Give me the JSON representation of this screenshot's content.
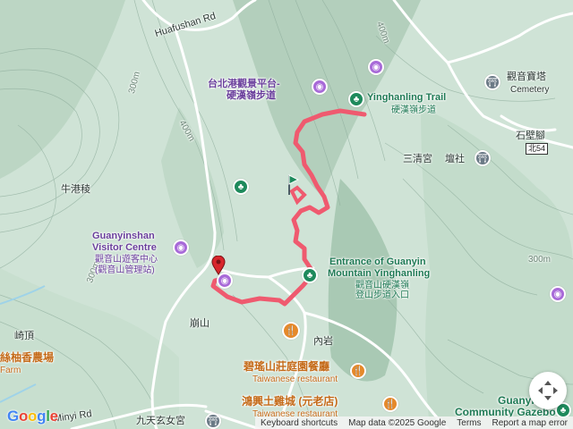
{
  "map": {
    "colors": {
      "terrain": "#cfe3d6",
      "ridge": "#9fc2ad",
      "contour": "#86a897",
      "road": "#ffffff",
      "route": "#ef5a6f",
      "water": "#9fd3e8"
    }
  },
  "labels": {
    "huafushan_rd": "Huafushan Rd",
    "guanyin_viewing_zh": "台北港觀景平台-",
    "guanyin_viewing_zh2": "硬漢嶺步道",
    "yinghanling_trail": "Yinghanling Trail",
    "yinghanling_trail_zh": "硬漢嶺步道",
    "guanyin_temple_zh": "觀音寶塔",
    "cemetery": "Cemetery",
    "shibijiao": "石壁腳",
    "route_bei54": "北54",
    "sanqing": "三清宮",
    "tanshe": "壇社",
    "niugangleng": "牛港稜",
    "visitor_centre_en1": "Guanyinshan",
    "visitor_centre_en2": "Visitor Centre",
    "visitor_centre_zh1": "觀音山遊客中心",
    "visitor_centre_zh2": "(觀音山管理站)",
    "entrance_en1": "Entrance of Guanyin",
    "entrance_en2": "Mountain Yinghanling",
    "entrance_zh1": "觀音山硬漢嶺",
    "entrance_zh2": "登山步道入口",
    "bengshan": "崩山",
    "neiyan": "內岩",
    "qiding": "崎頂",
    "xiangnong_zh": "絲柚香農場",
    "farm": "Farm",
    "biluo_zh": "碧瑤山莊庭園餐廳",
    "taiwanese_restaurant_1": "Taiwanese restaurant",
    "hongxing_zh": "鴻興土雞城 (元老店)",
    "taiwanese_restaurant_2": "Taiwanese restaurant",
    "jiutian_zh": "九天玄女宮",
    "minyi_rd": "Minyi Rd",
    "guanyin_gazebo1": "Guanyin",
    "guanyin_gazebo2": "Community Gazebo",
    "elev_300": "300m",
    "elev_400a": "400m",
    "elev_400b": "400m",
    "elev_300b": "300m",
    "elev_300c": "300m"
  },
  "attribution": {
    "shortcuts": "Keyboard shortcuts",
    "map_data": "Map data ©2025 Google",
    "terms": "Terms",
    "report": "Report a map error"
  },
  "logo": {
    "g1": "G",
    "o1": "o",
    "o2": "o",
    "g2": "g",
    "l": "l",
    "e": "e"
  },
  "icons": {
    "attraction": "camera-icon",
    "park": "tree-icon",
    "restaurant": "fork-knife-icon",
    "worship": "temple-icon",
    "start": "flag-icon",
    "end": "map-pin-icon",
    "controls": "pan-control-icon"
  }
}
